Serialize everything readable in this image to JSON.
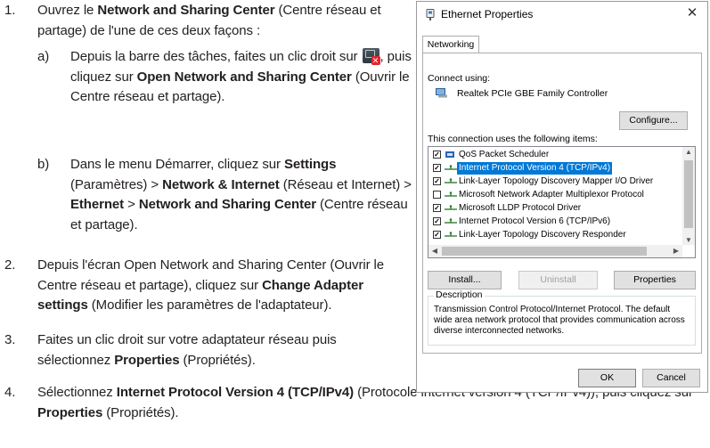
{
  "doc": {
    "step1": {
      "num": "1.",
      "pre": "Ouvrez le ",
      "bold": "Network and Sharing Center",
      "post": " (Centre réseau et partage) de l'une de ces deux façons :"
    },
    "step1a": {
      "num": "a)",
      "pre": "Depuis la barre des tâches, faites un clic droit sur ",
      "mid": ", puis cliquez sur ",
      "bold": "Open Network and Sharing Center",
      "post": " (Ouvrir le Centre réseau et partage)."
    },
    "step1b": {
      "num": "b)",
      "t1": "Dans le menu Démarrer, cliquez sur ",
      "b1": "Settings",
      "t2": " (Paramètres) > ",
      "b2": "Network & Internet",
      "t3": " (Réseau et Internet) > ",
      "b3": "Ethernet",
      "t4": " > ",
      "b4": "Network and Sharing Center",
      "t5": " (Centre réseau et partage)."
    },
    "step2": {
      "num": "2.",
      "pre": "Depuis l'écran Open Network and Sharing Center (Ouvrir le Centre réseau et partage), cliquez sur ",
      "bold": "Change Adapter settings",
      "post": " (Modifier les paramètres de l'adaptateur)."
    },
    "step3": {
      "num": "3.",
      "pre": "Faites un clic droit sur votre adaptateur réseau puis sélectionnez ",
      "bold": "Properties",
      "post": " (Propriétés)."
    },
    "step4": {
      "num": "4.",
      "pre": "Sélectionnez ",
      "b1": "Internet Protocol Version 4 (TCP/IPv4)",
      "mid": " (Protocole internet version 4 (TCP/IPv4)), puis cliquez sur ",
      "b2": "Properties",
      "post": " (Propriétés)."
    },
    "tray_icon": "network-error-tray-icon"
  },
  "dialog": {
    "title": "Ethernet Properties",
    "title_icon": "ethernet-adapter-icon",
    "close": "✕",
    "tab": "Networking",
    "connect_label": "Connect using:",
    "adapter": "Realtek PCIe GBE Family Controller",
    "configure": "Configure...",
    "items_label": "This connection uses the following items:",
    "items": [
      {
        "label": "QoS Packet Scheduler",
        "checked": true,
        "selected": false,
        "icon": "qos-icon"
      },
      {
        "label": "Internet Protocol Version 4 (TCP/IPv4)",
        "checked": true,
        "selected": true,
        "icon": "protocol-icon"
      },
      {
        "label": "Link-Layer Topology Discovery Mapper I/O Driver",
        "checked": true,
        "selected": false,
        "icon": "protocol-icon"
      },
      {
        "label": "Microsoft Network Adapter Multiplexor Protocol",
        "checked": false,
        "selected": false,
        "icon": "protocol-icon"
      },
      {
        "label": "Microsoft LLDP Protocol Driver",
        "checked": true,
        "selected": false,
        "icon": "protocol-icon"
      },
      {
        "label": "Internet Protocol Version 6 (TCP/IPv6)",
        "checked": true,
        "selected": false,
        "icon": "protocol-icon"
      },
      {
        "label": "Link-Layer Topology Discovery Responder",
        "checked": true,
        "selected": false,
        "icon": "protocol-icon"
      }
    ],
    "install": "Install...",
    "uninstall": "Uninstall",
    "properties": "Properties",
    "description_label": "Description",
    "description": "Transmission Control Protocol/Internet Protocol. The default wide area network protocol that provides communication across diverse interconnected networks.",
    "ok": "OK",
    "cancel": "Cancel"
  }
}
